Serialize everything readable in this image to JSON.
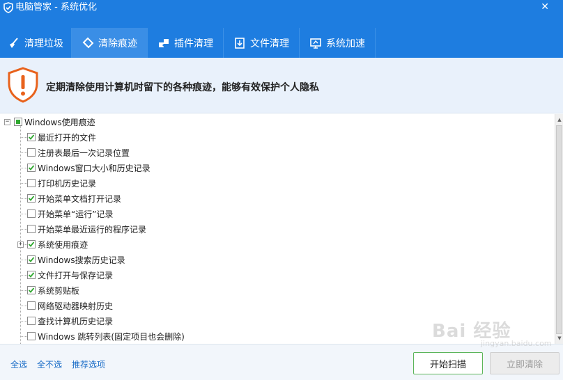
{
  "window": {
    "title": "电脑管家 - 系统优化",
    "close_glyph": "✕"
  },
  "tabs": [
    {
      "label": "清理垃圾",
      "icon": "broom-icon"
    },
    {
      "label": "清除痕迹",
      "icon": "eraser-icon",
      "active": true
    },
    {
      "label": "插件清理",
      "icon": "puzzle-icon"
    },
    {
      "label": "文件清理",
      "icon": "file-download-icon"
    },
    {
      "label": "系统加速",
      "icon": "monitor-icon"
    }
  ],
  "banner": {
    "message": "定期清除使用计算机时留下的各种痕迹，能够有效保护个人隐私",
    "icon": "warning-shield-icon"
  },
  "tree": {
    "root": {
      "label": "Windows使用痕迹",
      "state": "partial",
      "expander": "−"
    },
    "items": [
      {
        "label": "最近打开的文件",
        "checked": true
      },
      {
        "label": "注册表最后一次记录位置",
        "checked": false
      },
      {
        "label": "Windows窗口大小和历史记录",
        "checked": true
      },
      {
        "label": "打印机历史记录",
        "checked": false
      },
      {
        "label": "开始菜单文档打开记录",
        "checked": true
      },
      {
        "label": "开始菜单“运行”记录",
        "checked": false
      },
      {
        "label": "开始菜单最近运行的程序记录",
        "checked": false
      },
      {
        "label": "系统使用痕迹",
        "checked": true,
        "expander": "+"
      },
      {
        "label": "Windows搜索历史记录",
        "checked": true
      },
      {
        "label": "文件打开与保存记录",
        "checked": true
      },
      {
        "label": "系统剪贴板",
        "checked": true
      },
      {
        "label": "网络驱动器映射历史",
        "checked": false
      },
      {
        "label": "查找计算机历史记录",
        "checked": false
      },
      {
        "label": "Windows 跳转列表(固定项目也会删除)",
        "checked": false
      }
    ]
  },
  "footer": {
    "select_all": "全选",
    "select_none": "全不选",
    "recommended": "推荐选项",
    "scan_button": "开始扫描",
    "clean_button": "立即清除"
  },
  "watermark": {
    "main": "Bai 经验",
    "sub": "jingyan.baidu.com"
  },
  "colors": {
    "accent": "#1e7de0",
    "active_tab": "#3a8ee6",
    "check": "#2fa82f",
    "warning": "#e8621c"
  }
}
